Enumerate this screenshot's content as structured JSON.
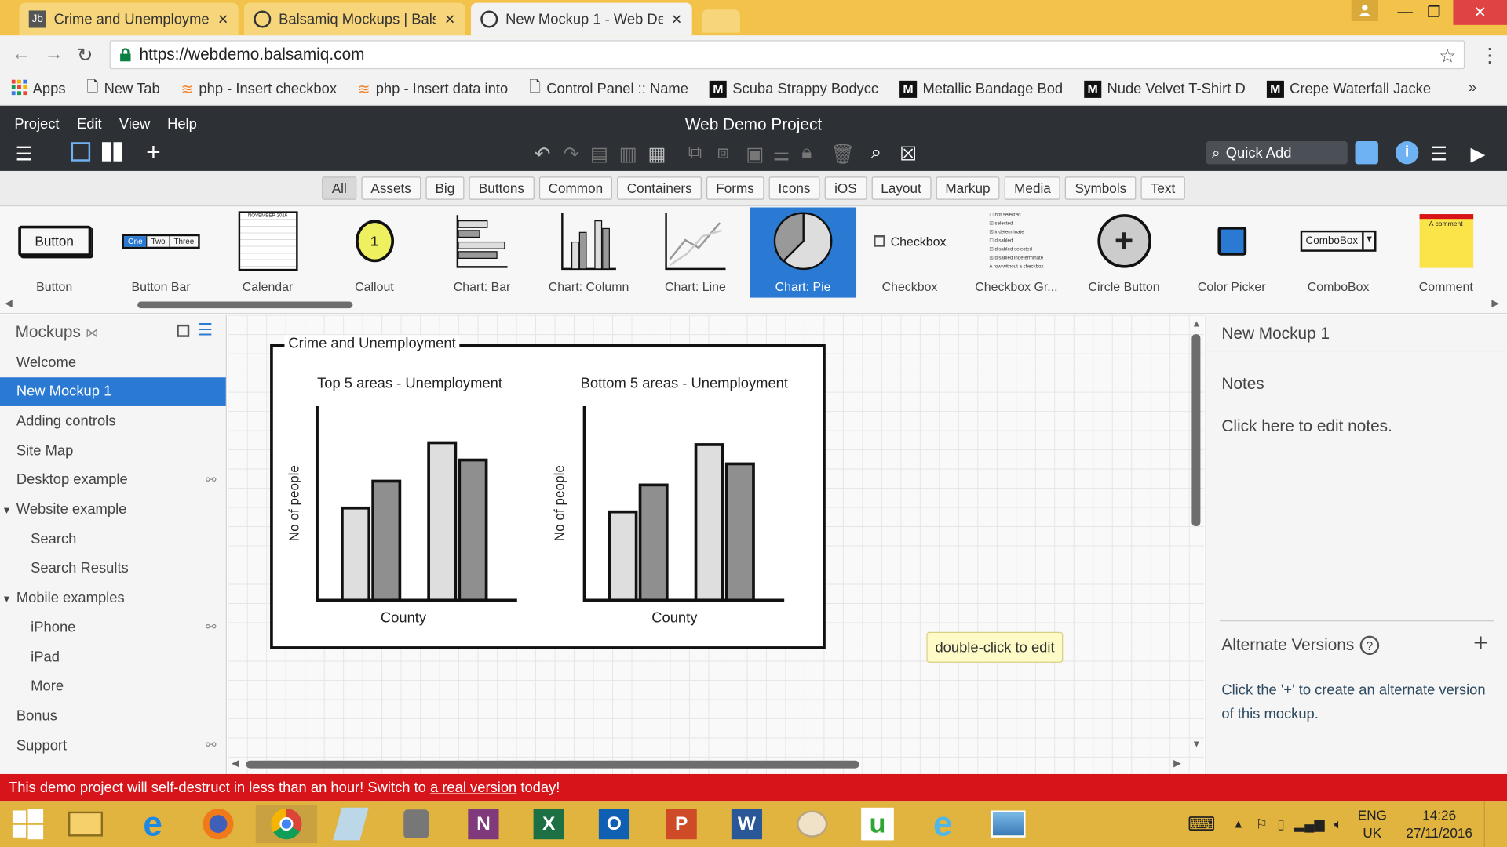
{
  "browser": {
    "tabs": [
      {
        "title": "Crime and Unemploymen",
        "active": false
      },
      {
        "title": "Balsamiq Mockups | Bals",
        "active": false
      },
      {
        "title": "New Mockup 1 - Web De",
        "active": true
      }
    ],
    "url": "https://webdemo.balsamiq.com",
    "bookmarks": [
      "Apps",
      "New Tab",
      "php - Insert checkbox",
      "php - Insert data into",
      "Control Panel :: Name",
      "Scuba Strappy Bodycc",
      "Metallic Bandage Bod",
      "Nude Velvet T-Shirt D",
      "Crepe Waterfall Jacke"
    ],
    "overflow": "»"
  },
  "app": {
    "menu": [
      "Project",
      "Edit",
      "View",
      "Help"
    ],
    "project_title": "Web Demo Project",
    "quick_add": "Quick Add"
  },
  "filters": {
    "items": [
      "All",
      "Assets",
      "Big",
      "Buttons",
      "Common",
      "Containers",
      "Forms",
      "Icons",
      "iOS",
      "Layout",
      "Markup",
      "Media",
      "Symbols",
      "Text"
    ],
    "selected": "All"
  },
  "library": {
    "items": [
      "Button",
      "Button Bar",
      "Calendar",
      "Callout",
      "Chart: Bar",
      "Chart: Column",
      "Chart: Line",
      "Chart: Pie",
      "Checkbox",
      "Checkbox Gr...",
      "Circle Button",
      "Color Picker",
      "ComboBox",
      "Comment"
    ],
    "selected": "Chart: Pie",
    "thumb_text": {
      "button": "Button",
      "buttonbar": [
        "One",
        "Two",
        "Three"
      ],
      "calendar_month": "NOVEMBER 2016",
      "callout": "1",
      "checkbox": "Checkbox",
      "combobox": "ComboBox",
      "comment": "A comment",
      "checkbox_group": [
        "not selected",
        "selected",
        "indeterminate",
        "disabled",
        "disabled selected",
        "disabled indeterminate",
        "A row without a checkbox"
      ]
    }
  },
  "sidebar": {
    "title": "Mockups",
    "items": [
      {
        "label": "Welcome",
        "level": 0,
        "selected": false,
        "link": false,
        "arrow": false
      },
      {
        "label": "New Mockup 1",
        "level": 0,
        "selected": true,
        "link": false,
        "arrow": false
      },
      {
        "label": "Adding controls",
        "level": 0,
        "selected": false,
        "link": false,
        "arrow": false
      },
      {
        "label": "Site Map",
        "level": 0,
        "selected": false,
        "link": false,
        "arrow": false
      },
      {
        "label": "Desktop example",
        "level": 0,
        "selected": false,
        "link": true,
        "arrow": false
      },
      {
        "label": "Website example",
        "level": 0,
        "selected": false,
        "link": false,
        "arrow": true
      },
      {
        "label": "Search",
        "level": 1,
        "selected": false,
        "link": false,
        "arrow": false
      },
      {
        "label": "Search Results",
        "level": 1,
        "selected": false,
        "link": false,
        "arrow": false
      },
      {
        "label": "Mobile examples",
        "level": 0,
        "selected": false,
        "link": false,
        "arrow": true
      },
      {
        "label": "iPhone",
        "level": 1,
        "selected": false,
        "link": true,
        "arrow": false
      },
      {
        "label": "iPad",
        "level": 1,
        "selected": false,
        "link": false,
        "arrow": false
      },
      {
        "label": "More",
        "level": 1,
        "selected": false,
        "link": false,
        "arrow": false
      },
      {
        "label": "Bonus",
        "level": 0,
        "selected": false,
        "link": false,
        "arrow": false
      },
      {
        "label": "Support",
        "level": 0,
        "selected": false,
        "link": true,
        "arrow": false
      }
    ]
  },
  "mockup": {
    "frame_title": "Crime and Unemployment",
    "tooltip": "double-click to edit"
  },
  "chart_data": [
    {
      "type": "bar",
      "title": "Top 5 areas - Unemployment",
      "xlabel": "County",
      "ylabel": "No of people",
      "values": [
        48,
        62,
        82,
        73
      ],
      "ylim": [
        0,
        100
      ],
      "colors": [
        "#dedede",
        "#8f8f8f",
        "#dedede",
        "#8f8f8f"
      ]
    },
    {
      "type": "bar",
      "title": "Bottom 5 areas - Unemployment",
      "xlabel": "County",
      "ylabel": "No of people",
      "values": [
        46,
        60,
        81,
        71
      ],
      "ylim": [
        0,
        100
      ],
      "colors": [
        "#dedede",
        "#8f8f8f",
        "#dedede",
        "#8f8f8f"
      ]
    }
  ],
  "right_panel": {
    "mockup_name": "New Mockup 1",
    "notes_heading": "Notes",
    "notes_text": "Click here to edit notes.",
    "alt_heading": "Alternate Versions",
    "alt_text": "Click the '+' to create an alternate version of this mockup."
  },
  "banner": {
    "prefix": "This demo project will self-destruct in less than an hour! Switch to ",
    "link": "a real version",
    "suffix": " today!"
  },
  "taskbar": {
    "lang": "ENG",
    "region": "UK",
    "time": "14:26",
    "date": "27/11/2016"
  },
  "colors": {
    "accent": "#2a7ad3",
    "app_header": "#2d3136",
    "banner": "#d8141b",
    "chrome_frame": "#f3c24b",
    "taskbar": "#e0b43f"
  }
}
